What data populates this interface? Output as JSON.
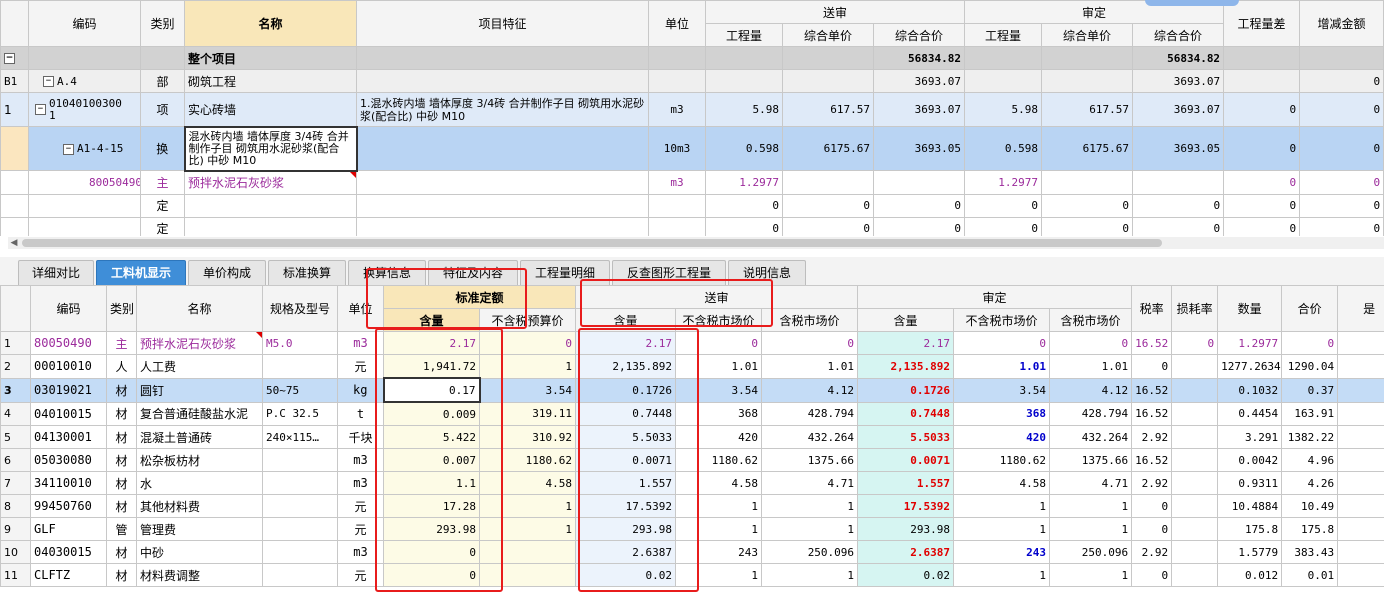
{
  "top": {
    "headers": {
      "code": "编码",
      "type": "类别",
      "name": "名称",
      "feature": "项目特征",
      "unit": "单位",
      "send_group": "送审",
      "audit_group": "审定",
      "qty": "工程量",
      "unit_price": "综合单价",
      "total_price": "综合合价",
      "qty_diff": "工程量差",
      "amount_diff": "增减金额"
    },
    "rows": [
      {
        "no": "",
        "code": "",
        "type": "",
        "name": "整个项目",
        "feature": "",
        "unit": "",
        "s_qty": "",
        "s_price": "",
        "s_total": "56834.82",
        "a_qty": "",
        "a_price": "",
        "a_total": "56834.82",
        "qty_diff": "",
        "amt_diff": ""
      },
      {
        "no": "B1",
        "code": "A.4",
        "type": "部",
        "name": "砌筑工程",
        "feature": "",
        "unit": "",
        "s_qty": "",
        "s_price": "",
        "s_total": "3693.07",
        "a_qty": "",
        "a_price": "",
        "a_total": "3693.07",
        "qty_diff": "",
        "amt_diff": "0"
      },
      {
        "no": "1",
        "code": "01040100300\n1",
        "type": "项",
        "name": "实心砖墙",
        "feature": "1.混水砖内墙 墙体厚度 3/4砖  合并制作子目 砌筑用水泥砂浆(配合比) 中砂 M10",
        "unit": "m3",
        "s_qty": "5.98",
        "s_price": "617.57",
        "s_total": "3693.07",
        "a_qty": "5.98",
        "a_price": "617.57",
        "a_total": "3693.07",
        "qty_diff": "0",
        "amt_diff": "0"
      },
      {
        "no": "",
        "code": "A1-4-15",
        "type": "换",
        "name": "混水砖内墙 墙体厚度 3/4砖 合并制作子目 砌筑用水泥砂浆(配合比) 中砂 M10",
        "feature": "",
        "unit": "10m3",
        "s_qty": "0.598",
        "s_price": "6175.67",
        "s_total": "3693.05",
        "a_qty": "0.598",
        "a_price": "6175.67",
        "a_total": "3693.05",
        "qty_diff": "0",
        "amt_diff": "0"
      },
      {
        "no": "",
        "code": "80050490",
        "type": "主",
        "name": "预拌水泥石灰砂浆",
        "feature": "",
        "unit": "m3",
        "s_qty": "1.2977",
        "s_price": "",
        "s_total": "",
        "a_qty": "1.2977",
        "a_price": "",
        "a_total": "",
        "qty_diff": "0",
        "amt_diff": "0"
      },
      {
        "no": "",
        "code": "",
        "type": "定",
        "name": "",
        "feature": "",
        "unit": "",
        "s_qty": "0",
        "s_price": "0",
        "s_total": "0",
        "a_qty": "0",
        "a_price": "0",
        "a_total": "0",
        "qty_diff": "0",
        "amt_diff": "0"
      },
      {
        "no": "",
        "code": "",
        "type": "定",
        "name": "",
        "feature": "",
        "unit": "",
        "s_qty": "0",
        "s_price": "0",
        "s_total": "0",
        "a_qty": "0",
        "a_price": "0",
        "a_total": "0",
        "qty_diff": "0",
        "amt_diff": "0"
      }
    ]
  },
  "tabs": [
    "详细对比",
    "工料机显示",
    "单价构成",
    "标准换算",
    "换算信息",
    "特征及内容",
    "工程量明细",
    "反查图形工程量",
    "说明信息"
  ],
  "active_tab": "工料机显示",
  "bottom": {
    "headers": {
      "code": "编码",
      "type": "类别",
      "name": "名称",
      "spec": "规格及型号",
      "unit": "单位",
      "std_group": "标准定额",
      "send_group": "送审",
      "audit_group": "审定",
      "content": "含量",
      "std_price": "不含税预算价",
      "ex_tax_price": "不含税市场价",
      "in_tax_price": "含税市场价",
      "tax_rate": "税率",
      "loss_rate": "损耗率",
      "qty": "数量",
      "total": "合价",
      "extra": "是"
    },
    "rows": [
      {
        "no": "1",
        "code": "80050490",
        "type": "主",
        "name": "预拌水泥石灰砂浆",
        "spec": "M5.0",
        "unit": "m3",
        "std_c": "2.17",
        "std_p": "0",
        "s_c": "2.17",
        "s_ex": "0",
        "s_in": "0",
        "a_c": "2.17",
        "a_ex": "0",
        "a_in": "0",
        "tax": "16.52",
        "loss": "0",
        "qty": "1.2977",
        "total": "0"
      },
      {
        "no": "2",
        "code": "00010010",
        "type": "人",
        "name": "人工费",
        "spec": "",
        "unit": "元",
        "std_c": "1,941.72",
        "std_p": "1",
        "s_c": "2,135.892",
        "s_ex": "1.01",
        "s_in": "1.01",
        "a_c": "2,135.892",
        "a_ex": "1.01",
        "a_in": "1.01",
        "tax": "0",
        "loss": "",
        "qty": "1277.2634",
        "total": "1290.04"
      },
      {
        "no": "3",
        "code": "03019021",
        "type": "材",
        "name": "圆钉",
        "spec": "50~75",
        "unit": "kg",
        "std_c": "0.17",
        "std_p": "3.54",
        "s_c": "0.1726",
        "s_ex": "3.54",
        "s_in": "4.12",
        "a_c": "0.1726",
        "a_ex": "3.54",
        "a_in": "4.12",
        "tax": "16.52",
        "loss": "",
        "qty": "0.1032",
        "total": "0.37"
      },
      {
        "no": "4",
        "code": "04010015",
        "type": "材",
        "name": "复合普通硅酸盐水泥",
        "spec": "P.C 32.5",
        "unit": "t",
        "std_c": "0.009",
        "std_p": "319.11",
        "s_c": "0.7448",
        "s_ex": "368",
        "s_in": "428.794",
        "a_c": "0.7448",
        "a_ex": "368",
        "a_in": "428.794",
        "tax": "16.52",
        "loss": "",
        "qty": "0.4454",
        "total": "163.91"
      },
      {
        "no": "5",
        "code": "04130001",
        "type": "材",
        "name": "混凝土普通砖",
        "spec": "240×115…",
        "unit": "千块",
        "std_c": "5.422",
        "std_p": "310.92",
        "s_c": "5.5033",
        "s_ex": "420",
        "s_in": "432.264",
        "a_c": "5.5033",
        "a_ex": "420",
        "a_in": "432.264",
        "tax": "2.92",
        "loss": "",
        "qty": "3.291",
        "total": "1382.22"
      },
      {
        "no": "6",
        "code": "05030080",
        "type": "材",
        "name": "松杂板枋材",
        "spec": "",
        "unit": "m3",
        "std_c": "0.007",
        "std_p": "1180.62",
        "s_c": "0.0071",
        "s_ex": "1180.62",
        "s_in": "1375.66",
        "a_c": "0.0071",
        "a_ex": "1180.62",
        "a_in": "1375.66",
        "tax": "16.52",
        "loss": "",
        "qty": "0.0042",
        "total": "4.96"
      },
      {
        "no": "7",
        "code": "34110010",
        "type": "材",
        "name": "水",
        "spec": "",
        "unit": "m3",
        "std_c": "1.1",
        "std_p": "4.58",
        "s_c": "1.557",
        "s_ex": "4.58",
        "s_in": "4.71",
        "a_c": "1.557",
        "a_ex": "4.58",
        "a_in": "4.71",
        "tax": "2.92",
        "loss": "",
        "qty": "0.9311",
        "total": "4.26"
      },
      {
        "no": "8",
        "code": "99450760",
        "type": "材",
        "name": "其他材料费",
        "spec": "",
        "unit": "元",
        "std_c": "17.28",
        "std_p": "1",
        "s_c": "17.5392",
        "s_ex": "1",
        "s_in": "1",
        "a_c": "17.5392",
        "a_ex": "1",
        "a_in": "1",
        "tax": "0",
        "loss": "",
        "qty": "10.4884",
        "total": "10.49"
      },
      {
        "no": "9",
        "code": "GLF",
        "type": "管",
        "name": "管理费",
        "spec": "",
        "unit": "元",
        "std_c": "293.98",
        "std_p": "1",
        "s_c": "293.98",
        "s_ex": "1",
        "s_in": "1",
        "a_c": "293.98",
        "a_ex": "1",
        "a_in": "1",
        "tax": "0",
        "loss": "",
        "qty": "175.8",
        "total": "175.8"
      },
      {
        "no": "10",
        "code": "04030015",
        "type": "材",
        "name": "中砂",
        "spec": "",
        "unit": "m3",
        "std_c": "0",
        "std_p": "",
        "s_c": "2.6387",
        "s_ex": "243",
        "s_in": "250.096",
        "a_c": "2.6387",
        "a_ex": "243",
        "a_in": "250.096",
        "tax": "2.92",
        "loss": "",
        "qty": "1.5779",
        "total": "383.43"
      },
      {
        "no": "11",
        "code": "CLFTZ",
        "type": "材",
        "name": "材料费调整",
        "spec": "",
        "unit": "元",
        "std_c": "0",
        "std_p": "",
        "s_c": "0.02",
        "s_ex": "1",
        "s_in": "1",
        "a_c": "0.02",
        "a_ex": "1",
        "a_in": "1",
        "tax": "0",
        "loss": "",
        "qty": "0.012",
        "total": "0.01"
      }
    ]
  },
  "colors": {
    "accent": "#3f8ed8",
    "highlight": "#e81c1c",
    "purple": "#9b2a9b",
    "red": "#e00000",
    "blue": "#0000cc"
  }
}
